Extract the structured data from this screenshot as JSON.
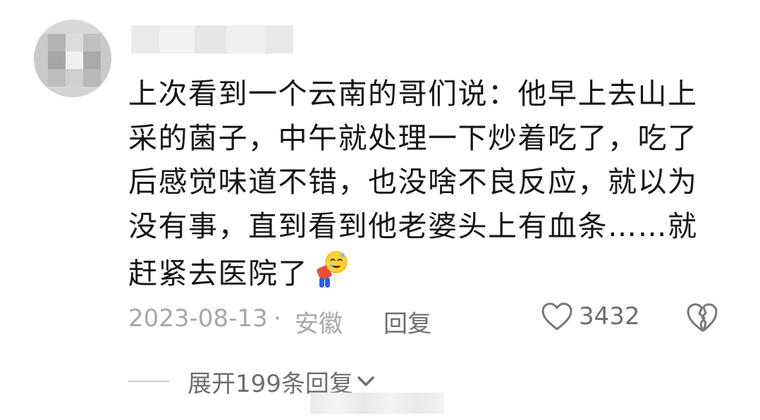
{
  "comment": {
    "lines": [
      "上次看到一个云南的哥们说：他早上去山上",
      "采的菌子，中午就处理一下炒着吃了，吃了",
      "后感觉味道不错，也没啥不良反应，就以为",
      "没有事，直到看到他老婆头上有血条……就",
      "赶紧去医院了"
    ],
    "emoji": "dizzy-bowing-person-icon"
  },
  "meta": {
    "date": "2023-08-13",
    "dot": "·",
    "location": "安徽",
    "reply_label": "回复",
    "like_count": "3432"
  },
  "expand": {
    "label": "展开199条回复"
  },
  "colors": {
    "text": "#161616",
    "meta": "#a7a7a7",
    "secondary": "#6e6e6e"
  }
}
